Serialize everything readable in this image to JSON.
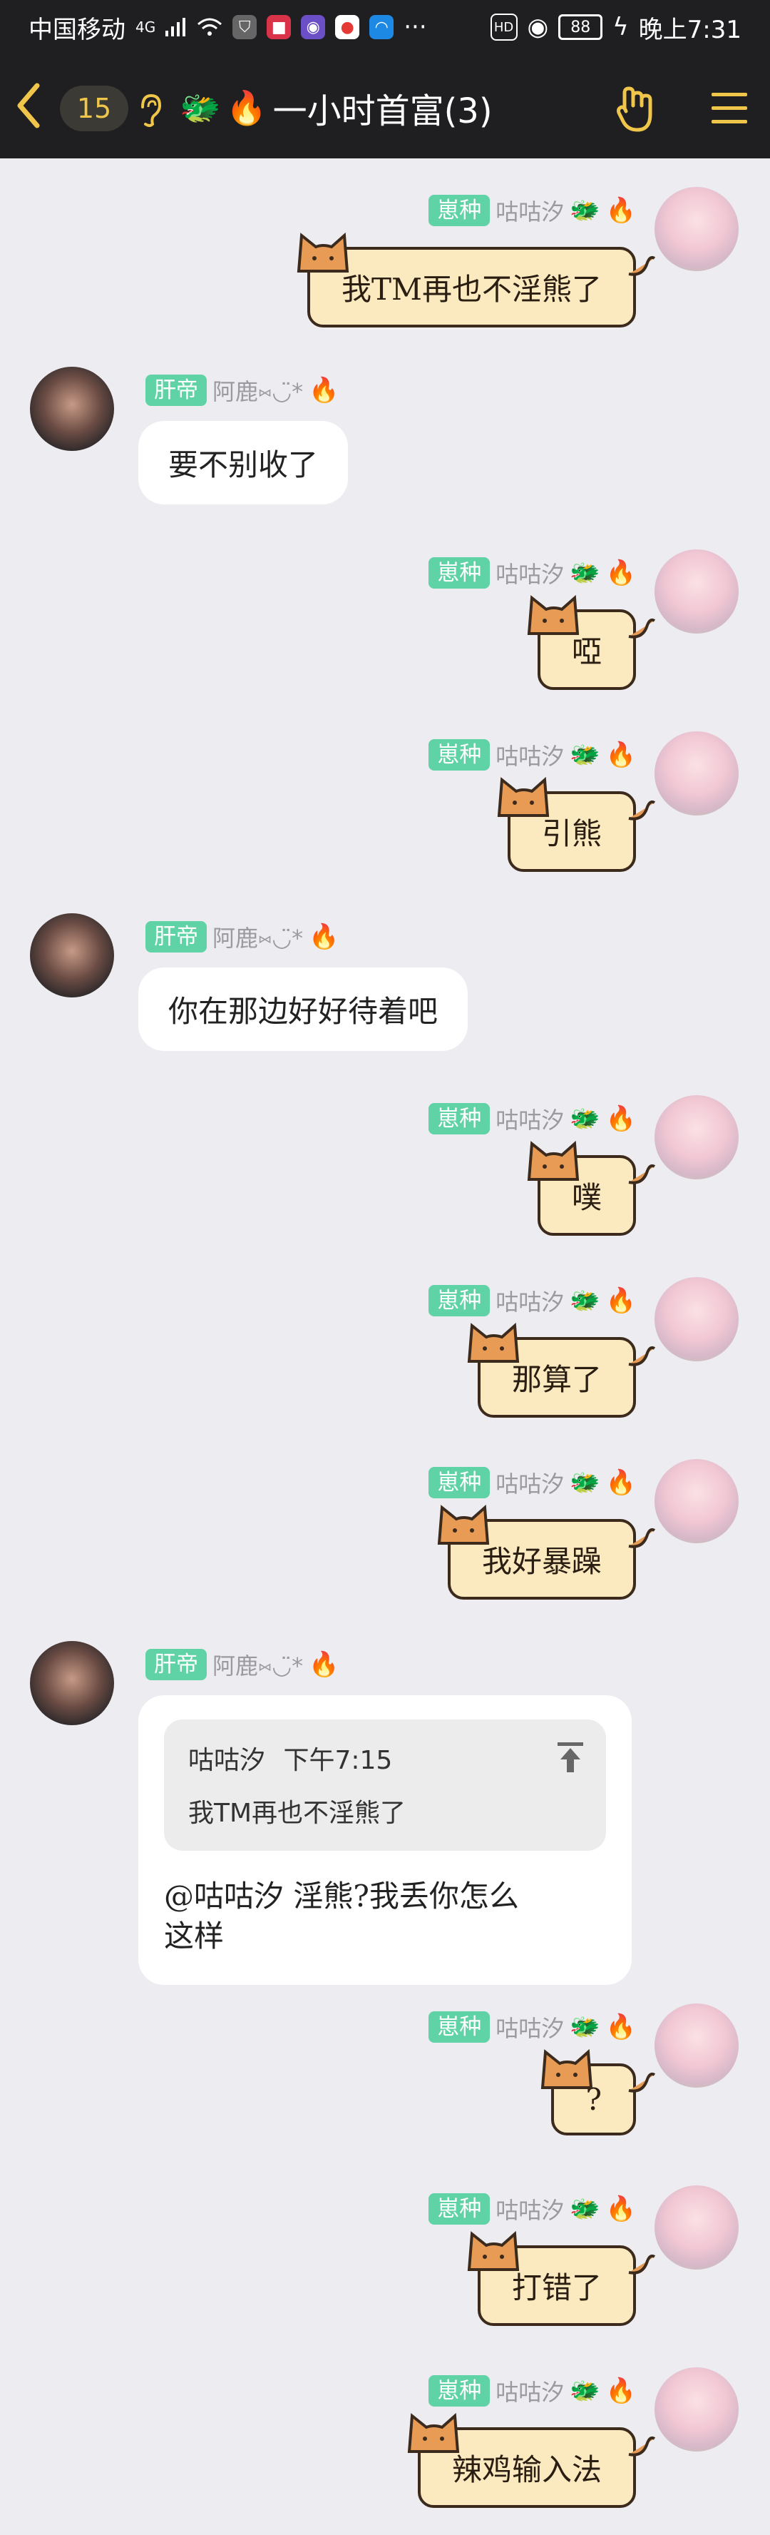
{
  "status_bar": {
    "carrier": "中国移动",
    "network": "4G",
    "battery": "88",
    "time": "晚上7:31",
    "more": "···"
  },
  "header": {
    "unread_count": "15",
    "group_title": "一小时首富(3)"
  },
  "messages": [
    {
      "side": "right",
      "tag": "崽种",
      "sender": "咕咕汐",
      "text": "我TM再也不淫熊了",
      "style": "cat"
    },
    {
      "side": "left",
      "tag": "肝帝",
      "sender": "阿鹿⑅◡̈*",
      "text": "要不别收了",
      "style": "white"
    },
    {
      "side": "right",
      "tag": "崽种",
      "sender": "咕咕汐",
      "text": "啞",
      "style": "cat"
    },
    {
      "side": "right",
      "tag": "崽种",
      "sender": "咕咕汐",
      "text": "引熊",
      "style": "cat"
    },
    {
      "side": "left",
      "tag": "肝帝",
      "sender": "阿鹿⑅◡̈*",
      "text": "你在那边好好待着吧",
      "style": "white"
    },
    {
      "side": "right",
      "tag": "崽种",
      "sender": "咕咕汐",
      "text": "噗",
      "style": "cat"
    },
    {
      "side": "right",
      "tag": "崽种",
      "sender": "咕咕汐",
      "text": "那算了",
      "style": "cat"
    },
    {
      "side": "right",
      "tag": "崽种",
      "sender": "咕咕汐",
      "text": "我好暴躁",
      "style": "cat"
    },
    {
      "side": "left",
      "tag": "肝帝",
      "sender": "阿鹿⑅◡̈*",
      "style": "reply",
      "quote_author": "咕咕汐",
      "quote_time": "下午7:15",
      "quote_text": "我TM再也不淫熊了",
      "text_line1": "@咕咕汐 淫熊?我丢你怎么",
      "text_line2": "这样"
    },
    {
      "side": "right",
      "tag": "崽种",
      "sender": "咕咕汐",
      "text": "?",
      "style": "cat"
    },
    {
      "side": "right",
      "tag": "崽种",
      "sender": "咕咕汐",
      "text": "打错了",
      "style": "cat"
    },
    {
      "side": "right",
      "tag": "崽种",
      "sender": "咕咕汐",
      "text": "辣鸡输入法",
      "style": "cat"
    }
  ],
  "colors": {
    "header_bg": "#1f1f22",
    "chat_bg": "#ececf1",
    "tag_green": "#5fd3a6",
    "accent_gold": "#f0c64a",
    "cat_bubble": "#fbe9bf"
  },
  "icons": [
    "back-arrow-icon",
    "ear-icon",
    "dragon-icon",
    "fire-icon",
    "hand-icon",
    "menu-icon",
    "pin-icon"
  ]
}
